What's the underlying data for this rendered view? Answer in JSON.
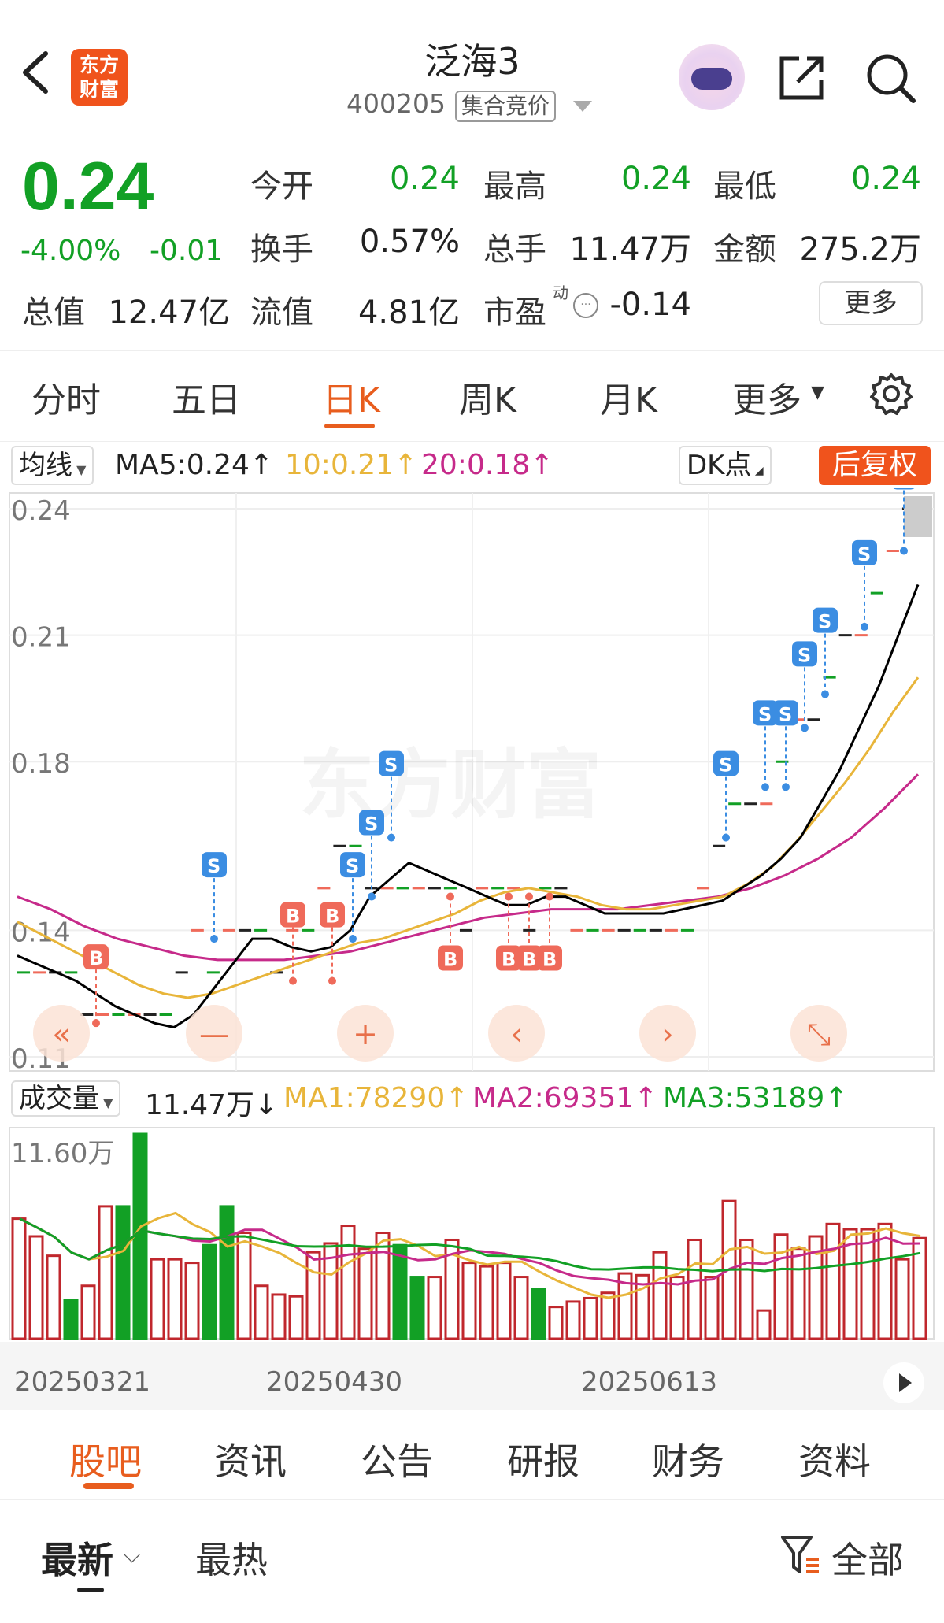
{
  "header": {
    "logo_text": "东方财富",
    "stock_name": "泛海3",
    "stock_code": "400205",
    "session_label": "集合竞价"
  },
  "quote": {
    "price": "0.24",
    "change_pct": "-4.00%",
    "change": "-0.01",
    "open_label": "今开",
    "open": "0.24",
    "high_label": "最高",
    "high": "0.24",
    "low_label": "最低",
    "low": "0.24",
    "turnover_label": "换手",
    "turnover": "0.57%",
    "volume_label": "总手",
    "volume": "11.47万",
    "amount_label": "金额",
    "amount": "275.2万",
    "mktcap_label": "总值",
    "mktcap": "12.47亿",
    "float_label": "流值",
    "float_cap": "4.81亿",
    "pe_label": "市盈",
    "pe_sup": "动",
    "pe": "-0.14",
    "more_label": "更多"
  },
  "period_tabs": [
    "分时",
    "五日",
    "日K",
    "周K",
    "月K",
    "更多"
  ],
  "active_period": "日K",
  "indicators": {
    "ma_selector": "均线",
    "ma5": "MA5:0.24↑",
    "ma10": "10:0.21↑",
    "ma20": "20:0.18↑",
    "dk_label": "DK点",
    "adjust_label": "后复权",
    "vol_selector": "成交量",
    "vol_value": "11.47万↓",
    "vol_ma1": "MA1:78290↑",
    "vol_ma2": "MA2:69351↑",
    "vol_ma3": "MA3:53189↑"
  },
  "colors": {
    "accent": "#e85d1e",
    "up": "#c0272d",
    "down": "#12a025",
    "ma5": "#000000",
    "ma10": "#e8b53a",
    "ma20": "#c62a8a",
    "signal_b": "#ef6a5a",
    "signal_s": "#3b8de2"
  },
  "watermark": "东方财富",
  "chart_data": {
    "type": "candlestick",
    "y_ticks": [
      "0.24",
      "0.21",
      "0.18",
      "0.14",
      "0.11"
    ],
    "ylim": [
      0.11,
      0.24
    ],
    "vol_max_label": "11.60万",
    "x_labels": [
      "20250321",
      "20250430",
      "20250613"
    ],
    "candles_close": [
      0.13,
      0.13,
      0.13,
      0.13,
      0.12,
      0.12,
      0.12,
      0.12,
      0.12,
      0.12,
      0.13,
      0.14,
      0.13,
      0.14,
      0.14,
      0.14,
      0.13,
      0.14,
      0.14,
      0.15,
      0.16,
      0.16,
      0.15,
      0.15,
      0.15,
      0.15,
      0.15,
      0.15,
      0.14,
      0.15,
      0.15,
      0.15,
      0.14,
      0.15,
      0.15,
      0.14,
      0.14,
      0.14,
      0.14,
      0.14,
      0.14,
      0.14,
      0.14,
      0.15,
      0.16,
      0.17,
      0.17,
      0.17,
      0.18,
      0.19,
      0.19,
      0.2,
      0.21,
      0.21,
      0.22,
      0.23,
      0.24
    ],
    "ma5": [
      0.134,
      0.132,
      0.13,
      0.128,
      0.125,
      0.122,
      0.12,
      0.118,
      0.117,
      0.12,
      0.126,
      0.132,
      0.138,
      0.138,
      0.136,
      0.135,
      0.136,
      0.14,
      0.148,
      0.152,
      0.156,
      0.154,
      0.152,
      0.15,
      0.148,
      0.146,
      0.146,
      0.148,
      0.148,
      0.146,
      0.144,
      0.144,
      0.144,
      0.144,
      0.145,
      0.146,
      0.147,
      0.15,
      0.153,
      0.157,
      0.162,
      0.17,
      0.178,
      0.188,
      0.198,
      0.21,
      0.222
    ],
    "ma10": [
      0.142,
      0.139,
      0.136,
      0.133,
      0.13,
      0.127,
      0.125,
      0.124,
      0.125,
      0.127,
      0.129,
      0.131,
      0.133,
      0.135,
      0.137,
      0.138,
      0.14,
      0.142,
      0.144,
      0.147,
      0.149,
      0.15,
      0.149,
      0.148,
      0.146,
      0.145,
      0.145,
      0.146,
      0.147,
      0.148,
      0.151,
      0.155,
      0.161,
      0.168,
      0.175,
      0.183,
      0.192,
      0.2
    ],
    "ma20": [
      0.148,
      0.145,
      0.141,
      0.138,
      0.136,
      0.134,
      0.133,
      0.133,
      0.133,
      0.134,
      0.135,
      0.137,
      0.139,
      0.141,
      0.143,
      0.144,
      0.145,
      0.145,
      0.145,
      0.146,
      0.147,
      0.148,
      0.15,
      0.153,
      0.157,
      0.162,
      0.169,
      0.177
    ],
    "volumes": [
      6.8,
      5.8,
      4.7,
      2.2,
      3.0,
      7.5,
      7.5,
      11.6,
      4.5,
      4.5,
      4.3,
      5.3,
      7.5,
      6.0,
      3.0,
      2.5,
      2.4,
      4.9,
      5.4,
      6.4,
      5.1,
      6.0,
      5.3,
      3.5,
      3.5,
      5.6,
      4.3,
      4.1,
      4.3,
      3.5,
      2.8,
      1.8,
      2.1,
      2.3,
      2.6,
      3.7,
      3.6,
      4.9,
      3.5,
      5.6,
      3.5,
      7.8,
      5.6,
      1.6,
      5.9,
      5.1,
      5.8,
      6.5,
      6.2,
      6.2,
      6.5,
      4.5,
      5.7
    ],
    "down_bars": [
      3,
      6,
      7,
      11,
      12,
      22,
      23,
      30
    ]
  },
  "bottom_tabs": [
    "股吧",
    "资讯",
    "公告",
    "研报",
    "财务",
    "资料"
  ],
  "active_bottom_tab": "股吧",
  "sort": {
    "newest": "最新",
    "hot": "最热",
    "filter_all": "全部"
  }
}
